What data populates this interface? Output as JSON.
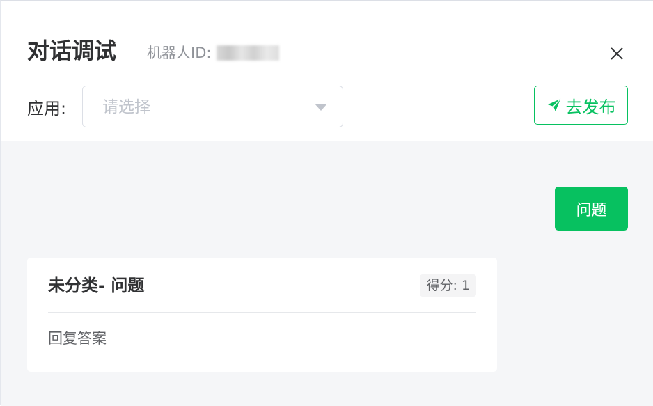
{
  "dialog": {
    "title": "对话调试",
    "robot_id_label": "机器人ID:",
    "close_icon": "close-icon"
  },
  "app_select": {
    "label": "应用:",
    "placeholder": "请选择",
    "caret_icon": "caret-down-icon"
  },
  "publish": {
    "icon": "send-icon",
    "label": "去发布"
  },
  "chat": {
    "question": "问题",
    "answer_card": {
      "title": "未分类- 问题",
      "score": "得分: 1",
      "answer": "回复答案"
    }
  },
  "colors": {
    "accent": "#07c160",
    "title_text": "#303133",
    "muted_text": "#909399",
    "body_bg": "#f5f6f8"
  }
}
